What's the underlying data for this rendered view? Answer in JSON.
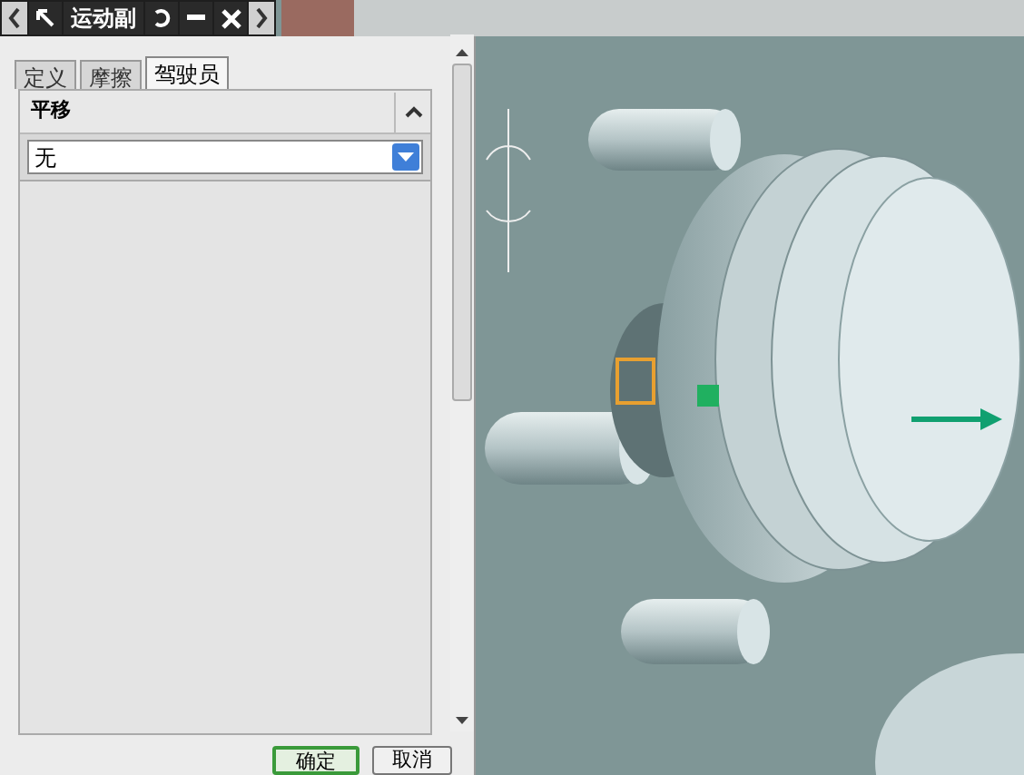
{
  "toolbar": {
    "title": "运动副"
  },
  "tabs": [
    {
      "label": "定义",
      "selected": false
    },
    {
      "label": "摩擦",
      "selected": false
    },
    {
      "label": "驾驶员",
      "selected": true
    }
  ],
  "section": {
    "title": "平移",
    "expanded": true,
    "dropdown": {
      "value": "无"
    }
  },
  "buttons": [
    {
      "label": "确定",
      "kind": "primary"
    },
    {
      "label": "取消",
      "kind": "secondary"
    }
  ]
}
